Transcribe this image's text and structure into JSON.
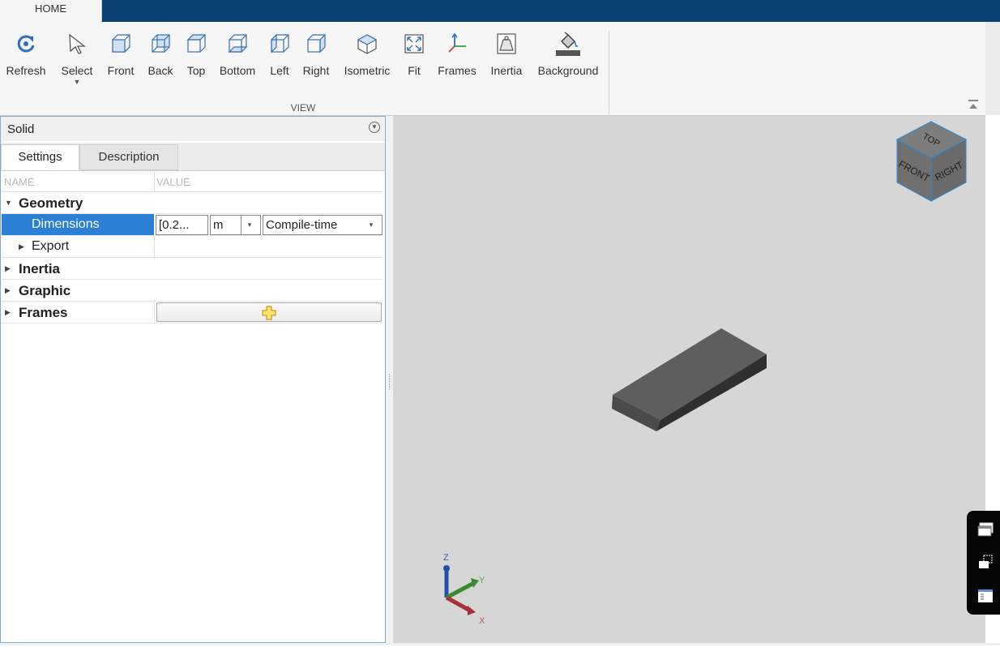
{
  "tab": {
    "home": "HOME"
  },
  "ribbon": {
    "buttons": [
      {
        "label": "Refresh",
        "icon": "refresh-icon"
      },
      {
        "label": "Select",
        "icon": "select-arrow-icon"
      },
      {
        "label": "Front",
        "icon": "front-view-icon"
      },
      {
        "label": "Back",
        "icon": "back-view-icon"
      },
      {
        "label": "Top",
        "icon": "top-view-icon"
      },
      {
        "label": "Bottom",
        "icon": "bottom-view-icon"
      },
      {
        "label": "Left",
        "icon": "left-view-icon"
      },
      {
        "label": "Right",
        "icon": "right-view-icon"
      },
      {
        "label": "Isometric",
        "icon": "isometric-view-icon"
      },
      {
        "label": "Fit",
        "icon": "fit-icon"
      },
      {
        "label": "Frames",
        "icon": "frames-icon"
      },
      {
        "label": "Inertia",
        "icon": "inertia-icon"
      },
      {
        "label": "Background",
        "icon": "background-bucket-icon"
      }
    ],
    "group_label": "VIEW"
  },
  "panel": {
    "title": "Solid",
    "tabs": [
      "Settings",
      "Description"
    ],
    "columns": {
      "name": "NAME",
      "value": "VALUE"
    },
    "rows": {
      "geometry": "Geometry",
      "dimensions": "Dimensions",
      "dimensions_value": "[0.2...",
      "dimensions_unit": "m",
      "dimensions_mode": "Compile-time",
      "export": "Export",
      "inertia": "Inertia",
      "graphic": "Graphic",
      "frames": "Frames"
    }
  },
  "viewcube": {
    "top": "TOP",
    "front": "FRONT",
    "right": "RIGHT"
  },
  "triad": {
    "x": "X",
    "y": "Y",
    "z": "Z"
  },
  "colors": {
    "titlebar": "#0b4276",
    "selection": "#2b7fd4",
    "viewport": "#d6d6d6"
  }
}
